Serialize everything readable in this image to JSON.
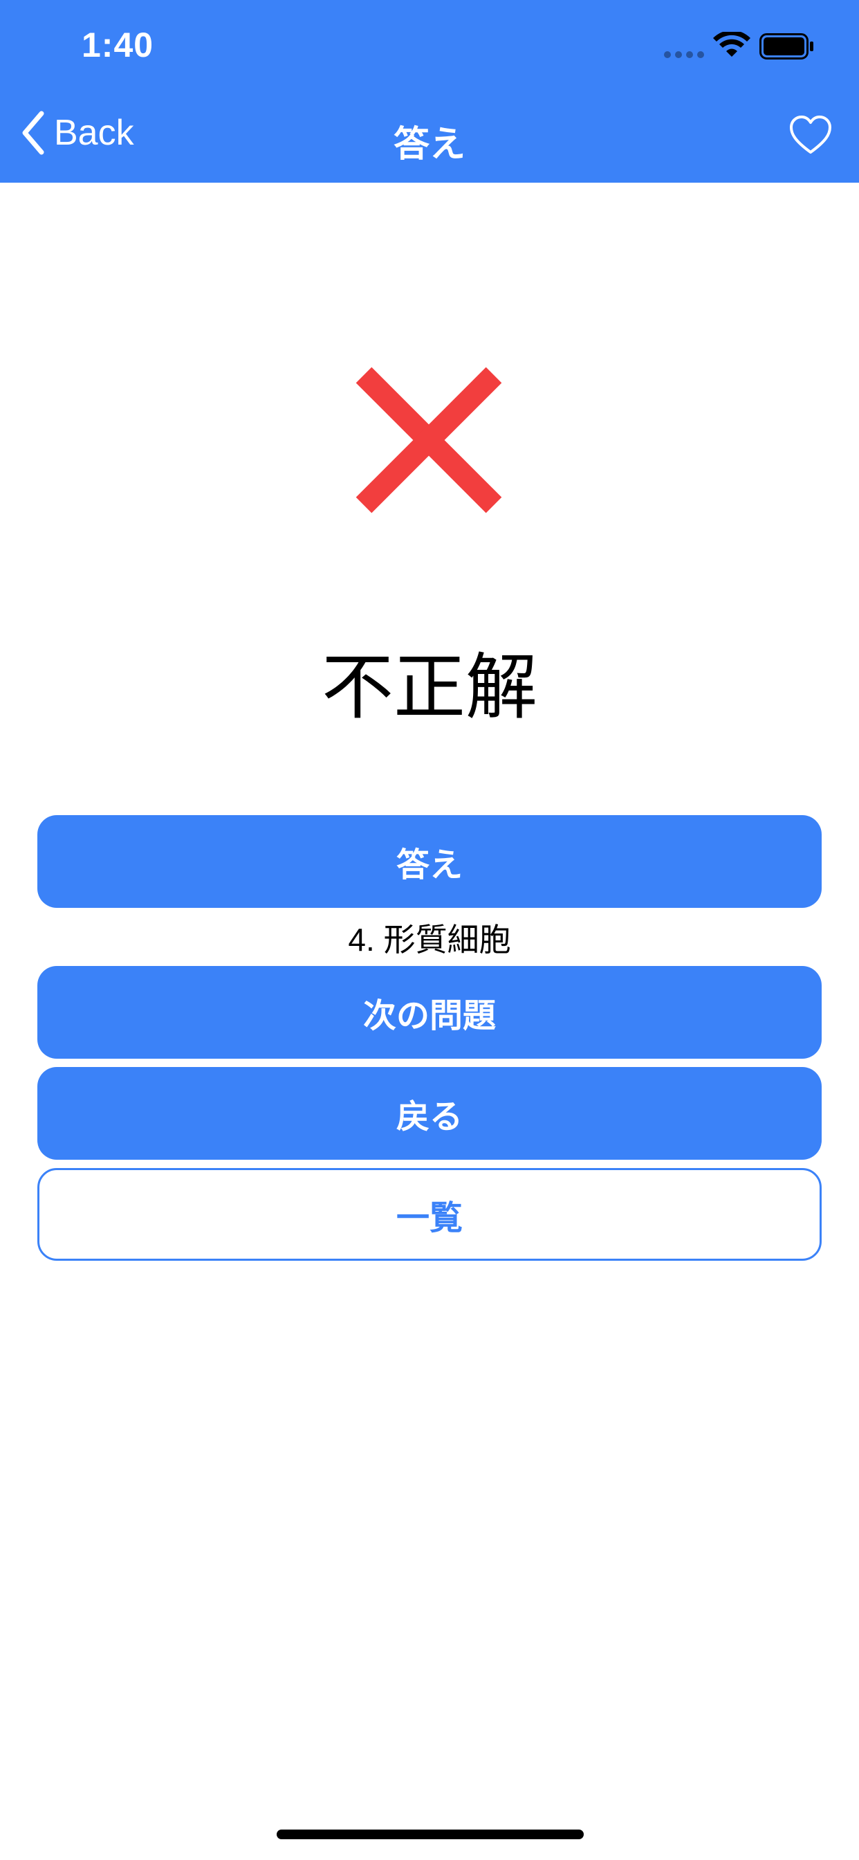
{
  "status_bar": {
    "time": "1:40"
  },
  "nav": {
    "back_label": "Back",
    "title": "答え",
    "back_icon": "chevron-left-icon",
    "favorite_icon": "heart-outline-icon"
  },
  "result": {
    "icon": "cross-icon",
    "icon_color": "#f23e3e",
    "label": "不正解"
  },
  "answer": {
    "button_label": "答え",
    "text": "4. 形質細胞"
  },
  "actions": {
    "next_label": "次の問題",
    "back_label": "戻る",
    "list_label": "一覧"
  },
  "colors": {
    "accent": "#3b82f8",
    "wrong": "#f23e3e"
  }
}
